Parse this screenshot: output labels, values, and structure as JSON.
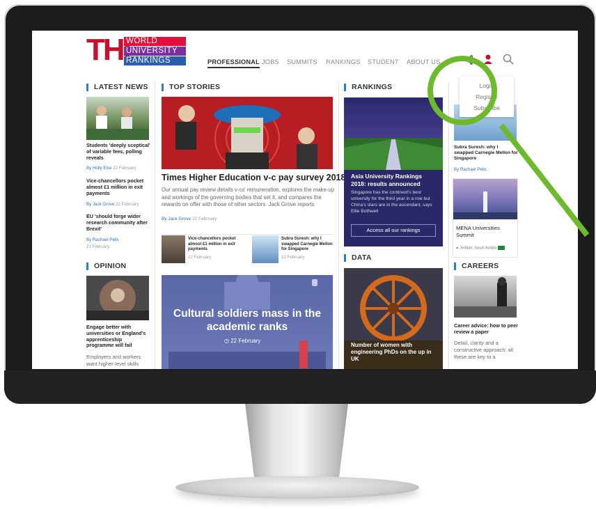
{
  "logo": {
    "mark": "THE",
    "line1": "WORLD",
    "line2": "UNIVERSITY",
    "line3": "RANKINGS"
  },
  "nav": [
    "PROFESSIONAL",
    "JOBS",
    "SUMMITS",
    "RANKINGS",
    "STUDENT",
    "ABOUT US"
  ],
  "dropdown": [
    "Login",
    "Register",
    "Subscribe"
  ],
  "sections": {
    "latest_news": "LATEST NEWS",
    "top_stories": "TOP STORIES",
    "rankings": "RANKINGS",
    "opinion": "OPINION",
    "data": "DATA",
    "careers": "CAREERS"
  },
  "latest_news": [
    {
      "title": "Students 'deeply sceptical' of variable fees, polling reveals",
      "author": "By Holly Else",
      "date": "22 February"
    },
    {
      "title": "Vice-chancellors pocket almost £1 million in exit payments",
      "author": "By Jack Grove",
      "date": "22 February"
    },
    {
      "title": "EU 'should forge wider research community after Brexit'",
      "author": "By Rachael Pells",
      "date": "21 February"
    }
  ],
  "opinion": {
    "title": "Engage better with universities or England's apprenticeship programme will fail",
    "text": "Employers and workers want higher-level skills"
  },
  "top_story": {
    "title": "Times Higher Education v-c pay survey 2018",
    "text": "Our annual pay review details v-cs' remuneration, explores the make-up and workings of the governing bodies that set it, and compares the rewards on offer with those of other sectors. Jack Grove reports",
    "author": "By Jack Grove",
    "date": "22 February"
  },
  "sub_stories": [
    {
      "title": "Vice-chancellors pocket almost £1 million in exit payments",
      "date": "22 February"
    },
    {
      "title": "Subra Suresh: why I swapped Carnegie Mellon for Singapore",
      "date": "22 February"
    }
  ],
  "cultural": {
    "title": "Cultural soldiers mass in the academic ranks",
    "date": "22 February"
  },
  "rankings_card": {
    "title": "Asia University Rankings 2018: results announced",
    "text": "Singapore has the continent's best university for the third year in a row but China's stars are in the ascendant, says Ellie Bothwell",
    "button": "Access all our rankings"
  },
  "data_card": {
    "title": "Number of women with engineering PhDs on the up in UK"
  },
  "right_col": {
    "story": {
      "title": "Subra Suresh: why I swapped Carnegie Mellon for Singapore",
      "author": "By Rachael Pells"
    },
    "mena": {
      "title": "MENA Universities Summit",
      "location": "Jeddah, Saudi Arabia"
    },
    "career": {
      "title": "Career advice: how to peer review a paper",
      "text": "Detail, clarity and a constructive approach: all these are key to a"
    }
  },
  "colors": {
    "brand_red": "#c8102e",
    "accent_blue": "#2a7fd4",
    "highlight_green": "#6fba2c",
    "rankings_bg": "#2a2866"
  }
}
